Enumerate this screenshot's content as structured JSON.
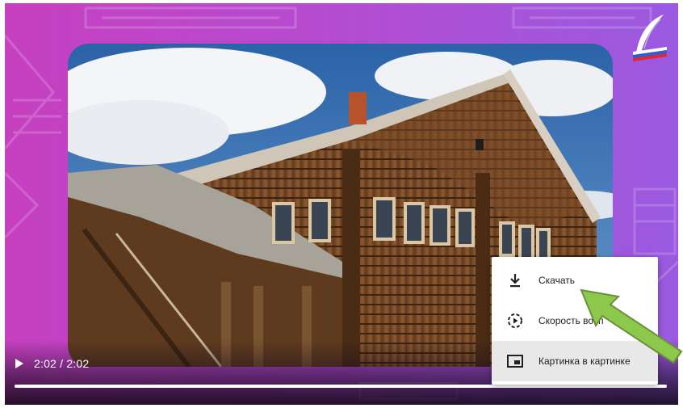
{
  "player": {
    "current_time": "2:02",
    "time_separator": " / ",
    "duration": "2:02",
    "progress": 1.0
  },
  "context_menu": {
    "items": [
      {
        "label": "Скачать",
        "icon": "download-icon"
      },
      {
        "label": "Скорость восп",
        "icon": "playback-speed-icon"
      },
      {
        "label": "Картинка в картинке",
        "icon": "picture-in-picture-icon"
      }
    ]
  },
  "colors": {
    "background_left": "#c640c0",
    "background_right": "#9a5ae0",
    "annotation_arrow": "#8cc84b"
  }
}
